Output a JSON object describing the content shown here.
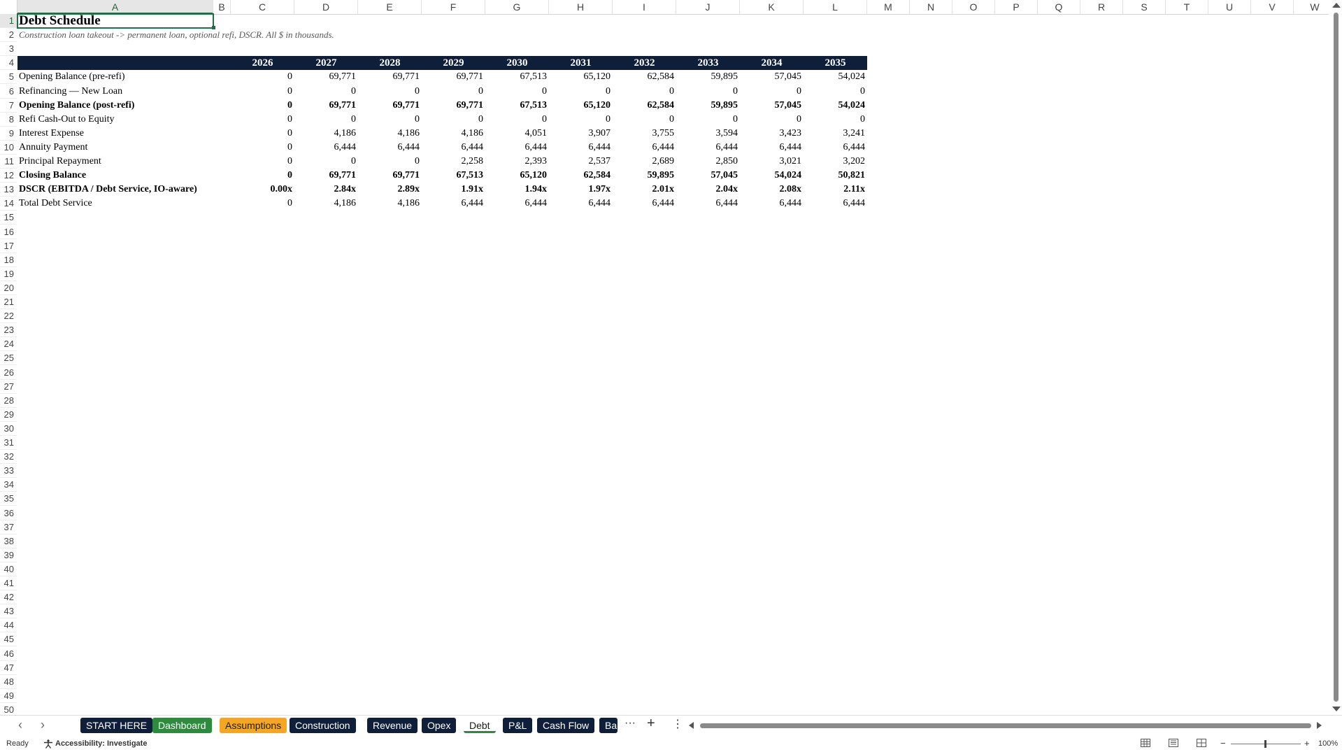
{
  "columns": [
    {
      "id": "A",
      "w": 280
    },
    {
      "id": "B",
      "w": 25
    },
    {
      "id": "C",
      "w": 91
    },
    {
      "id": "D",
      "w": 91
    },
    {
      "id": "E",
      "w": 91
    },
    {
      "id": "F",
      "w": 91
    },
    {
      "id": "G",
      "w": 91
    },
    {
      "id": "H",
      "w": 91
    },
    {
      "id": "I",
      "w": 91
    },
    {
      "id": "J",
      "w": 91
    },
    {
      "id": "K",
      "w": 91
    },
    {
      "id": "L",
      "w": 91
    },
    {
      "id": "M",
      "w": 61
    },
    {
      "id": "N",
      "w": 61
    },
    {
      "id": "O",
      "w": 61
    },
    {
      "id": "P",
      "w": 61
    },
    {
      "id": "Q",
      "w": 61
    },
    {
      "id": "R",
      "w": 61
    },
    {
      "id": "S",
      "w": 61
    },
    {
      "id": "T",
      "w": 61
    },
    {
      "id": "U",
      "w": 61
    },
    {
      "id": "V",
      "w": 61
    },
    {
      "id": "W",
      "w": 61
    }
  ],
  "row_count": 50,
  "active_cell": {
    "col": "A",
    "row": 1
  },
  "sheet": {
    "title": "Debt Schedule",
    "subtitle": "Construction loan takeout -> permanent loan, optional refi, DSCR. All $ in thousands.",
    "years": [
      "2026",
      "2027",
      "2028",
      "2029",
      "2030",
      "2031",
      "2032",
      "2033",
      "2034",
      "2035"
    ],
    "rows": [
      {
        "label": "Opening Balance (pre-refi)",
        "bold": false,
        "values": [
          "0",
          "69,771",
          "69,771",
          "69,771",
          "67,513",
          "65,120",
          "62,584",
          "59,895",
          "57,045",
          "54,024"
        ]
      },
      {
        "label": "Refinancing — New Loan",
        "bold": false,
        "values": [
          "0",
          "0",
          "0",
          "0",
          "0",
          "0",
          "0",
          "0",
          "0",
          "0"
        ]
      },
      {
        "label": "Opening Balance (post-refi)",
        "bold": true,
        "values": [
          "0",
          "69,771",
          "69,771",
          "69,771",
          "67,513",
          "65,120",
          "62,584",
          "59,895",
          "57,045",
          "54,024"
        ]
      },
      {
        "label": "Refi Cash-Out to Equity",
        "bold": false,
        "values": [
          "0",
          "0",
          "0",
          "0",
          "0",
          "0",
          "0",
          "0",
          "0",
          "0"
        ]
      },
      {
        "label": "Interest Expense",
        "bold": false,
        "values": [
          "0",
          "4,186",
          "4,186",
          "4,186",
          "4,051",
          "3,907",
          "3,755",
          "3,594",
          "3,423",
          "3,241"
        ]
      },
      {
        "label": "Annuity Payment",
        "bold": false,
        "values": [
          "0",
          "6,444",
          "6,444",
          "6,444",
          "6,444",
          "6,444",
          "6,444",
          "6,444",
          "6,444",
          "6,444"
        ]
      },
      {
        "label": "Principal Repayment",
        "bold": false,
        "values": [
          "0",
          "0",
          "0",
          "2,258",
          "2,393",
          "2,537",
          "2,689",
          "2,850",
          "3,021",
          "3,202"
        ]
      },
      {
        "label": "Closing Balance",
        "bold": true,
        "values": [
          "0",
          "69,771",
          "69,771",
          "67,513",
          "65,120",
          "62,584",
          "59,895",
          "57,045",
          "54,024",
          "50,821"
        ]
      },
      {
        "label": "DSCR (EBITDA / Debt Service, IO-aware)",
        "bold": true,
        "values": [
          "0.00x",
          "2.84x",
          "2.89x",
          "1.91x",
          "1.94x",
          "1.97x",
          "2.01x",
          "2.04x",
          "2.08x",
          "2.11x"
        ]
      },
      {
        "label": "Total Debt Service",
        "bold": false,
        "values": [
          "0",
          "4,186",
          "4,186",
          "6,444",
          "6,444",
          "6,444",
          "6,444",
          "6,444",
          "6,444",
          "6,444"
        ]
      }
    ]
  },
  "tabs": [
    {
      "label": "START HERE",
      "style": "dark"
    },
    {
      "label": "Dashboard",
      "style": "green"
    },
    {
      "label": "Assumptions",
      "style": "orange"
    },
    {
      "label": "Construction",
      "style": "dark"
    },
    {
      "label": "Revenue",
      "style": "dark"
    },
    {
      "label": "Opex",
      "style": "dark"
    },
    {
      "label": "Debt",
      "style": "active"
    },
    {
      "label": "P&L",
      "style": "dark"
    },
    {
      "label": "Cash Flow",
      "style": "dark"
    },
    {
      "label": "Ba",
      "style": "dark"
    }
  ],
  "tab_tools": {
    "more": "···",
    "add": "+",
    "menu": "⋮"
  },
  "nav": {
    "prev": "‹",
    "next": "›"
  },
  "status": {
    "ready": "Ready",
    "accessibility": "Accessibility: Investigate",
    "zoom": "100%",
    "zoom_minus": "−",
    "zoom_plus": "+"
  }
}
